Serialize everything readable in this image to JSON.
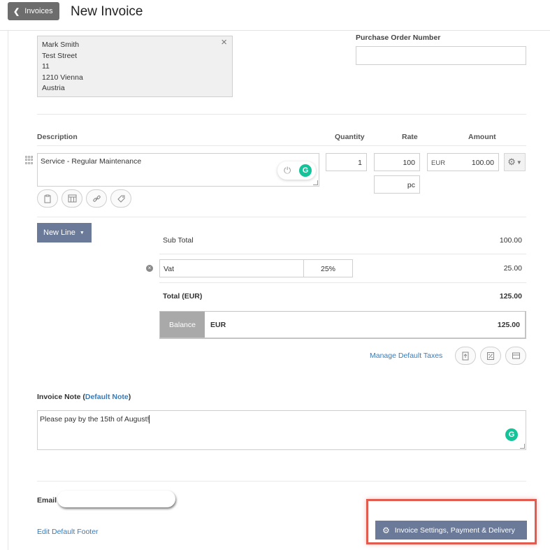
{
  "header": {
    "back_label": "Invoices",
    "title": "New Invoice"
  },
  "address": {
    "lines": [
      "Mark Smith",
      "Test Street",
      "11",
      "1210 Vienna",
      "Austria"
    ]
  },
  "purchase_order": {
    "label": "Purchase Order Number",
    "value": ""
  },
  "items": {
    "headers": {
      "description": "Description",
      "quantity": "Quantity",
      "rate": "Rate",
      "amount": "Amount"
    },
    "rows": [
      {
        "description": "Service - Regular Maintenance",
        "quantity": "1",
        "rate": "100",
        "unit": "pc",
        "currency": "EUR",
        "amount": "100.00"
      }
    ],
    "new_line_label": "New Line"
  },
  "totals": {
    "subtotal_label": "Sub Total",
    "subtotal_value": "100.00",
    "tax_name": "Vat",
    "tax_rate": "25%",
    "tax_value": "25.00",
    "total_label": "Total (EUR)",
    "total_value": "125.00",
    "balance_label": "Balance",
    "balance_currency": "EUR",
    "balance_value": "125.00",
    "manage_taxes_label": "Manage Default Taxes"
  },
  "note": {
    "label": "Invoice Note",
    "default_link": "Default Note",
    "value": "Please pay by the 15th of August!"
  },
  "footer": {
    "email_label": "Email",
    "edit_footer_label": "Edit Default Footer",
    "settings_button_label": "Invoice Settings, Payment & Delivery"
  },
  "colors": {
    "accent_button": "#6b7a99",
    "link": "#3a7ab5",
    "grammarly": "#15c39a",
    "highlight": "#e25b4f"
  },
  "icons": {
    "back": "chevron-left-icon",
    "close": "close-icon",
    "drag": "drag-handle-icon",
    "grammarly": "grammarly-icon",
    "gear": "gear-icon"
  }
}
